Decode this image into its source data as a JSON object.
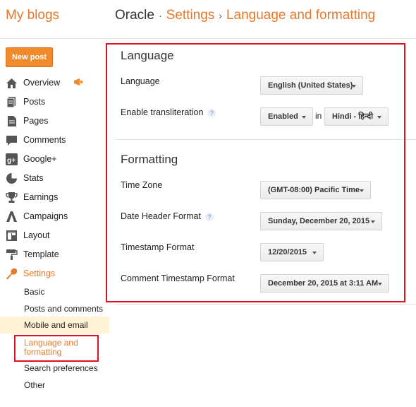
{
  "header": {
    "logo": "My blogs",
    "breadcrumb": {
      "blog": "Oracle",
      "separator1": "·",
      "section": "Settings",
      "separator2": "›",
      "page": "Language and formatting"
    }
  },
  "new_post_label": "New post",
  "nav": {
    "items": [
      {
        "label": "Overview",
        "icon": "home-icon"
      },
      {
        "label": "Posts",
        "icon": "posts-icon"
      },
      {
        "label": "Pages",
        "icon": "pages-icon"
      },
      {
        "label": "Comments",
        "icon": "comments-icon"
      },
      {
        "label": "Google+",
        "icon": "google-plus-icon"
      },
      {
        "label": "Stats",
        "icon": "stats-icon"
      },
      {
        "label": "Earnings",
        "icon": "trophy-icon"
      },
      {
        "label": "Campaigns",
        "icon": "campaigns-icon"
      },
      {
        "label": "Layout",
        "icon": "layout-icon"
      },
      {
        "label": "Template",
        "icon": "paint-roller-icon"
      },
      {
        "label": "Settings",
        "icon": "wrench-icon"
      }
    ],
    "settings_sub": [
      {
        "label": "Basic"
      },
      {
        "label": "Posts and comments"
      },
      {
        "label": "Mobile and email"
      },
      {
        "label": "Language and",
        "label2": "formatting"
      },
      {
        "label": "Search preferences"
      },
      {
        "label": "Other"
      }
    ]
  },
  "language_section": {
    "title": "Language",
    "language_label": "Language",
    "language_value": "English (United States)",
    "transliteration_label": "Enable transliteration",
    "help": "?",
    "transliteration_value": "Enabled",
    "in_label": "in",
    "transliteration_lang": "Hindi - हिन्दी"
  },
  "formatting_section": {
    "title": "Formatting",
    "timezone_label": "Time Zone",
    "timezone_value": "(GMT-08:00) Pacific Time",
    "date_header_label": "Date Header Format",
    "help": "?",
    "date_header_value": "Sunday, December 20, 2015",
    "timestamp_label": "Timestamp Format",
    "timestamp_value": "12/20/2015",
    "comment_timestamp_label": "Comment Timestamp Format",
    "comment_timestamp_value": "December 20, 2015 at 3:11 AM"
  },
  "colors": {
    "accent": "#e8782a",
    "highlight_box": "#e01020",
    "button": "#f08a2d"
  }
}
